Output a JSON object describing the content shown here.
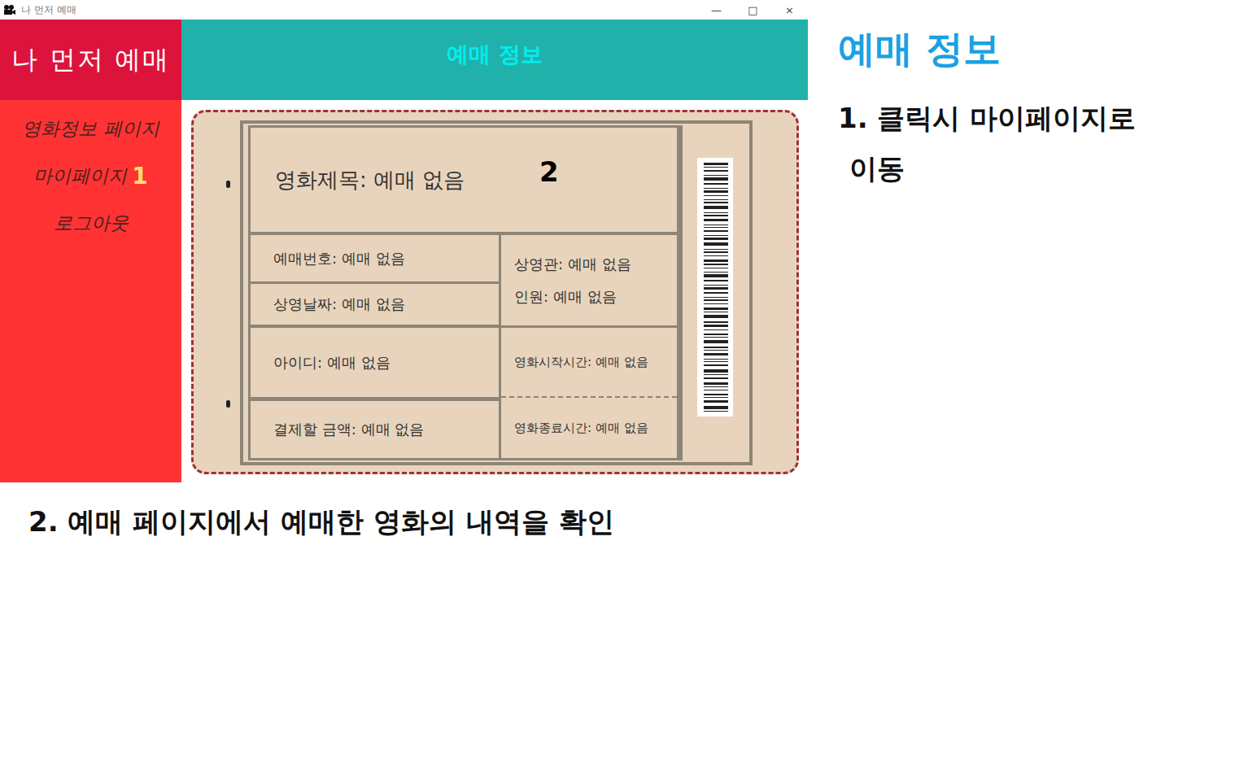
{
  "window": {
    "title": "나 먼저 예매",
    "controls": [
      "—",
      "□",
      "×"
    ]
  },
  "sidebar": {
    "brand": "나 먼저 예매",
    "items": [
      {
        "label": "영화정보 페이지",
        "marker": ""
      },
      {
        "label": "마이페이지",
        "marker": "1"
      },
      {
        "label": "로그아웃",
        "marker": ""
      }
    ]
  },
  "header": {
    "title": "예매 정보"
  },
  "ticket": {
    "marker": "2",
    "title": "영화제목: 예매 없음",
    "left": [
      "예매번호: 예매 없음",
      "상영날짜: 예매 없음",
      "아이디: 예매 없음",
      "결제할 금액: 예매 없음"
    ],
    "right": [
      [
        "상영관: 예매 없음",
        "인원: 예매 없음"
      ],
      [
        "영화시작시간: 예매 없음"
      ],
      [
        "영화종료시간: 예매 없음"
      ]
    ]
  },
  "notes": {
    "title": "예매 정보",
    "items": [
      "1. 클릭시 마이페이지로",
      "이동"
    ],
    "caption": "2. 예매 페이지에서 예매한 영화의 내역을 확인"
  }
}
